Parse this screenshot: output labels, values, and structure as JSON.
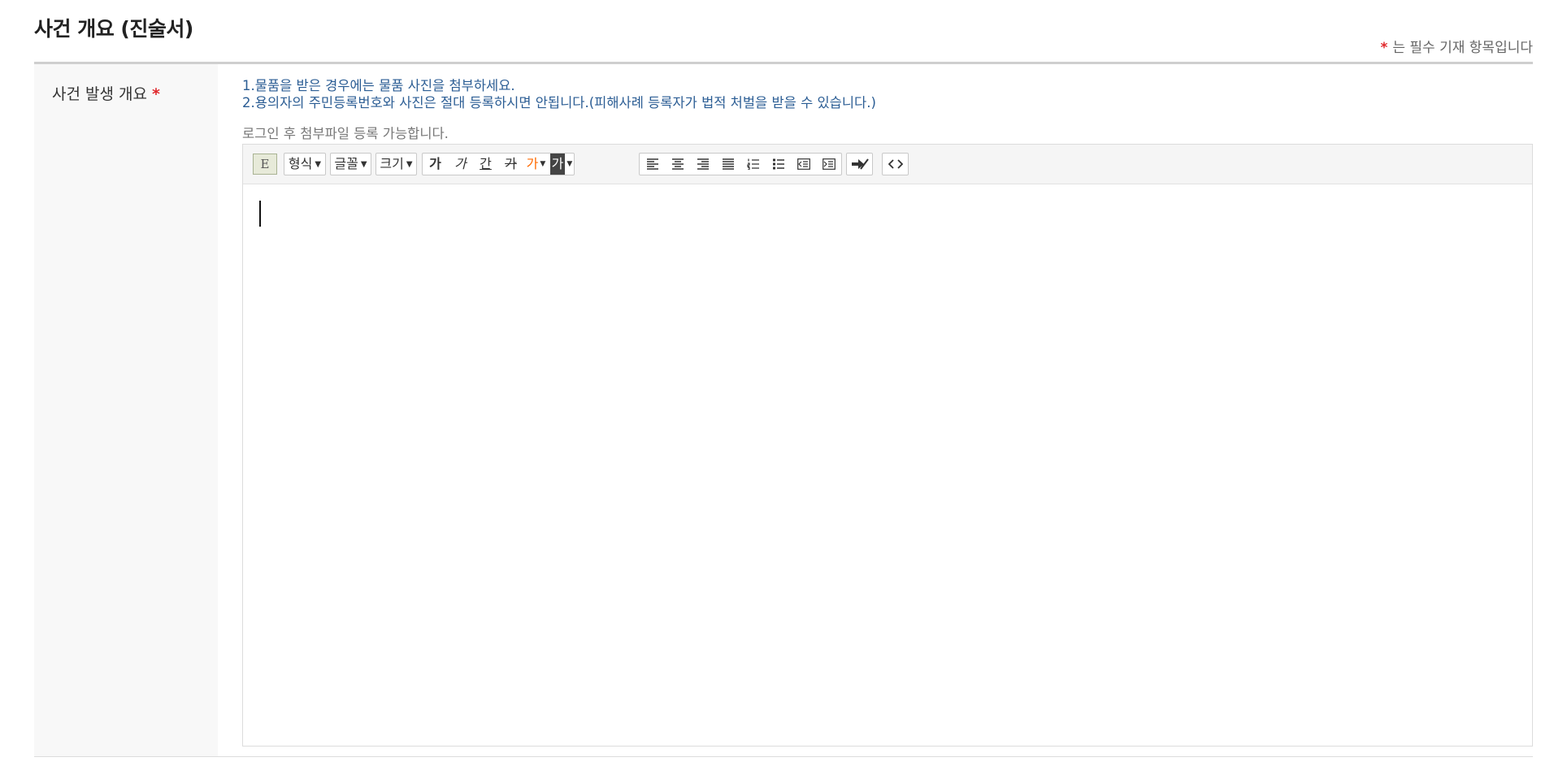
{
  "section": {
    "title": "사건 개요 (진술서)",
    "required_note": "는 필수 기재 항목입니다",
    "required_mark": "*"
  },
  "field": {
    "label": "사건 발생 개요",
    "required_mark": "*",
    "guide_lines": [
      "1.물품을 받은 경우에는 물품 사진을 첨부하세요.",
      "2.용의자의 주민등록번호와 사진은 절대 등록하시면 안됩니다.(피해사례 등록자가 법적 처벌을 받을 수 있습니다.)"
    ],
    "login_note": "로그인 후 첨부파일 등록 가능합니다."
  },
  "toolbar": {
    "editor_mode": "E",
    "format_label": "형식",
    "font_label": "글꼴",
    "size_label": "크기",
    "bold_label": "가",
    "italic_label": "가",
    "underline_label": "간",
    "strike_label": "가",
    "font_color_label": "가",
    "bg_color_label": "가",
    "icons": [
      "align-left-icon",
      "align-center-icon",
      "align-right-icon",
      "align-justify-icon",
      "ordered-list-icon",
      "unordered-list-icon",
      "outdent-icon",
      "indent-icon",
      "clear-format-icon",
      "source-code-icon"
    ]
  },
  "colors": {
    "required_star": "#e0272b",
    "guide_text": "#2b5d94",
    "font_color_swatch": "#ff6a00"
  }
}
